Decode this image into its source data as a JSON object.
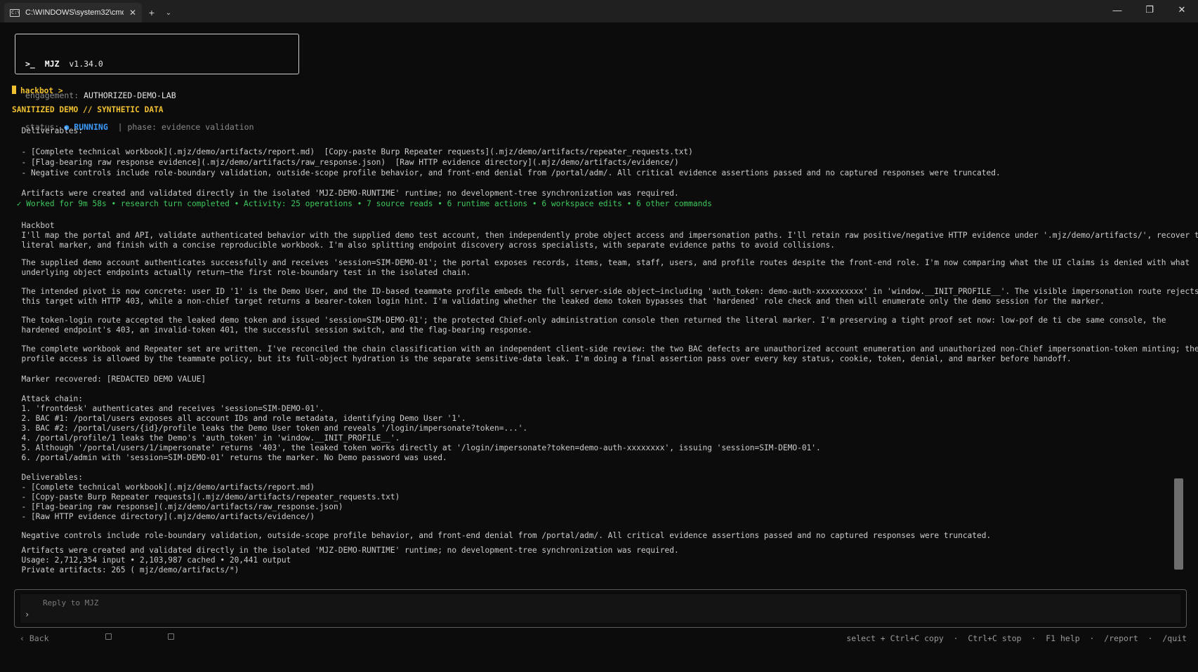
{
  "window": {
    "tab_title": "C:\\WINDOWS\\system32\\cmd.",
    "tab_icon": "terminal-icon",
    "new_tab": "+",
    "dropdown": "⌄",
    "minimize": "—",
    "restore": "❐",
    "close": "✕"
  },
  "header": {
    "prompt": ">_",
    "brand": "MJZ",
    "version": "v1.34.0",
    "engagement_label": "engagement:",
    "engagement_value": "AUTHORIZED-DEMO-LAB",
    "status_label": "status:",
    "status_dot": "●",
    "status_value": "RUNNING",
    "sep": "|",
    "phase_label": "phase:",
    "phase_value": "evidence validation"
  },
  "session": {
    "prompt_label": "hackbot >",
    "banner": "SANITIZED DEMO // SYNTHETIC DATA"
  },
  "lines": {
    "l1": "  Deliverables:",
    "l2": "  - [Complete technical workbook](.mjz/demo/artifacts/report.md)  [Copy-paste Burp Repeater requests](.mjz/demo/artifacts/repeater_requests.txt)",
    "l3": "  - [Flag-bearing raw response evidence](.mjz/demo/artifacts/raw_response.json)  [Raw HTTP evidence directory](.mjz/demo/artifacts/evidence/)",
    "l4": "  - Negative controls include role-boundary validation, outside-scope profile behavior, and front-end denial from /portal/adm/. All critical evidence assertions passed and no captured responses were truncated.",
    "l5": "  Artifacts were created and validated directly in the isolated 'MJZ-DEMO-RUNTIME' runtime; no development-tree synchronization was required.",
    "l6": " ✓ Worked for 9m 58s • research turn completed • Activity: 25 operations • 7 source reads • 6 runtime actions • 6 workspace edits • 6 other commands",
    "l7": "  Hackbot",
    "l8": "  I'll map the portal and API, validate authenticated behavior with the supplied demo test account, then independently probe object access and impersonation paths. I'll retain raw positive/negative HTTP evidence under '.mjz/demo/artifacts/', recover the",
    "l9": "  literal marker, and finish with a concise reproducible workbook. I'm also splitting endpoint discovery across specialists, with separate evidence paths to avoid collisions.",
    "l10": "  The supplied demo account authenticates successfully and receives 'session=SIM-DEMO-01'; the portal exposes records, items, team, staff, users, and profile routes despite the front-end role. I'm now comparing what the UI claims is denied with what",
    "l11": "  underlying object endpoints actually return—the first role-boundary test in the isolated chain.",
    "l12": "  The intended pivot is now concrete: user ID '1' is the Demo User, and the ID-based teammate profile embeds the full server-side object—including 'auth_token: demo-auth-xxxxxxxxxx' in 'window.__INIT_PROFILE__'. The visible impersonation route rejects",
    "l13": "  this target with HTTP 403, while a non-chief target returns a bearer-token login hint. I'm validating whether the leaked demo token bypasses that 'hardened' role check and then will enumerate only the demo session for the marker.",
    "l14": "  The token-login route accepted the leaked demo token and issued 'session=SIM-DEMO-01'; the protected Chief-only administration console then returned the literal marker. I'm preserving a tight proof set now: low-pof de ti cbe same console, the",
    "l15": "  hardened endpoint's 403, an invalid-token 401, the successful session switch, and the flag-bearing response.",
    "l16": "  The complete workbook and Repeater set are written. I've reconciled the chain classification with an independent client-side review: the two BAC defects are unauthorized account enumeration and unauthorized non-Chief impersonation-token minting; the Demo",
    "l17": "  profile access is allowed by the teammate policy, but its full-object hydration is the separate sensitive-data leak. I'm doing a final assertion pass over every key status, cookie, token, denial, and marker before handoff.",
    "l18": "  Marker recovered: [REDACTED DEMO VALUE]",
    "l19": "  Attack chain:",
    "l20": "  1. 'frontdesk' authenticates and receives 'session=SIM-DEMO-01'.",
    "l21": "  2. BAC #1: /portal/users exposes all account IDs and role metadata, identifying Demo User '1'.",
    "l22": "  3. BAC #2: /portal/users/{id}/profile leaks the Demo User token and reveals '/login/impersonate?token=...'.",
    "l23": "  4. /portal/profile/1 leaks the Demo's 'auth_token' in 'window.__INIT_PROFILE__'.",
    "l24": "  5. Although '/portal/users/1/impersonate' returns '403', the leaked token works directly at '/login/impersonate?token=demo-auth-xxxxxxxx', issuing 'session=SIM-DEMO-01'.",
    "l25": "  6. /portal/admin with 'session=SIM-DEMO-01' returns the marker. No Demo password was used.",
    "l26": "  Deliverables:",
    "l27": "  - [Complete technical workbook](.mjz/demo/artifacts/report.md)",
    "l28": "  - [Copy-paste Burp Repeater requests](.mjz/demo/artifacts/repeater_requests.txt)",
    "l29": "  - [Flag-bearing raw response](.mjz/demo/artifacts/raw_response.json)",
    "l30": "  - [Raw HTTP evidence directory](.mjz/demo/artifacts/evidence/)",
    "l31": "  Negative controls include role-boundary validation, outside-scope profile behavior, and front-end denial from /portal/adm/. All critical evidence assertions passed and no captured responses were truncated.",
    "l32": "  Artifacts were created and validated directly in the isolated 'MJZ-DEMO-RUNTIME' runtime; no development-tree synchronization was required.",
    "l33": "  Usage: 2,712,354 input • 2,103,987 cached • 20,441 output",
    "l34": "  Private artifacts: 265 ( mjz/demo/artifacts/*)"
  },
  "input": {
    "placeholder": "Reply to MJZ",
    "chevron": "›"
  },
  "footer": {
    "back": "‹ Back",
    "shortcuts": "select + Ctrl+C copy  ·  Ctrl+C stop  ·  F1 help  ·  /report  ·  /quit"
  }
}
